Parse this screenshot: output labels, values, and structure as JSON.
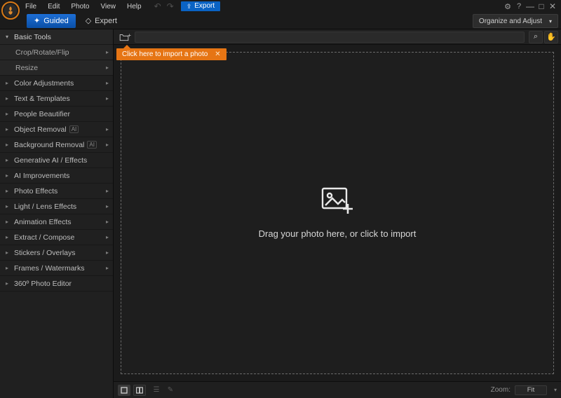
{
  "menu": {
    "items": [
      "File",
      "Edit",
      "Photo",
      "View",
      "Help"
    ],
    "export": "Export"
  },
  "window_controls": {
    "gear": "⚙",
    "help": "?",
    "min": "—",
    "max": "□",
    "close": "✕"
  },
  "mode_tabs": {
    "guided": "Guided",
    "expert": "Expert"
  },
  "organize_btn": "Organize and Adjust",
  "sidebar": {
    "basic_tools": "Basic Tools",
    "crop": "Crop/Rotate/Flip",
    "resize": "Resize",
    "items": [
      "Color Adjustments",
      "Text & Templates",
      "People Beautifier",
      "Object Removal",
      "Background Removal",
      "Generative AI / Effects",
      "AI Improvements",
      "Photo Effects",
      "Light / Lens Effects",
      "Animation Effects",
      "Extract / Compose",
      "Stickers / Overlays",
      "Frames / Watermarks",
      "360º Photo Editor"
    ],
    "chevron_flags": [
      true,
      true,
      false,
      true,
      true,
      false,
      false,
      true,
      true,
      true,
      true,
      true,
      true,
      false
    ],
    "ai_badge_flags": [
      false,
      false,
      false,
      true,
      true,
      false,
      false,
      false,
      false,
      false,
      false,
      false,
      false,
      false
    ]
  },
  "tooltip": {
    "text": "Click here to import a photo",
    "close": "✕"
  },
  "canvas": {
    "text": "Drag your photo here, or click to import"
  },
  "status": {
    "zoom_label": "Zoom:",
    "zoom_value": "Fit"
  }
}
